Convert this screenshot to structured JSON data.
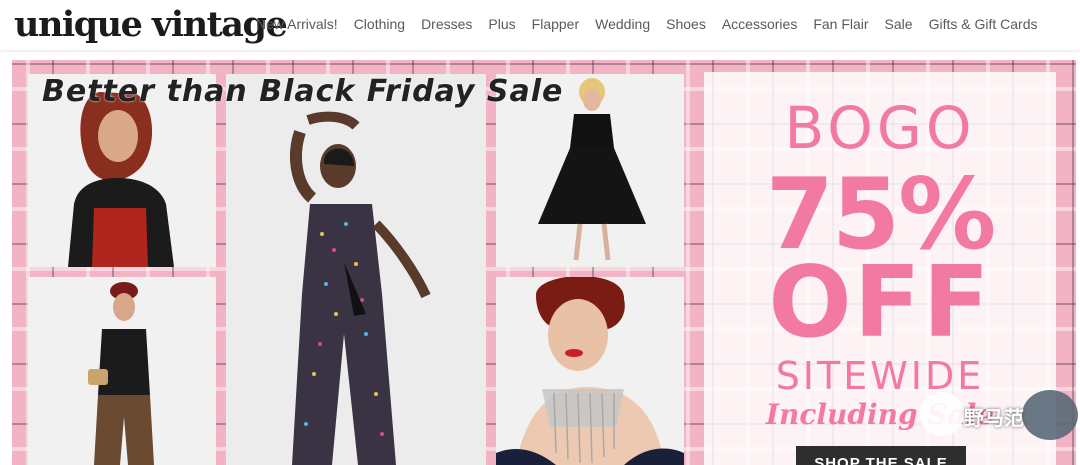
{
  "header": {
    "logo": "unique vintage",
    "nav": [
      "New Arrivals!",
      "Clothing",
      "Dresses",
      "Plus",
      "Flapper",
      "Wedding",
      "Shoes",
      "Accessories",
      "Fan Flair",
      "Sale",
      "Gifts & Gift Cards"
    ]
  },
  "hero": {
    "headline": "Better than Black Friday Sale",
    "bogo": "BOGO",
    "percent": "75%",
    "off": "OFF",
    "sitewide": "SITEWIDE",
    "including": "Including Sale",
    "cta": "SHOP THE SALE"
  },
  "watermark": {
    "text": "野马范"
  },
  "colors": {
    "accent_pink": "#f27aa2",
    "plaid_pink": "#f2b4c4",
    "button_dark": "#2e2e2e"
  }
}
